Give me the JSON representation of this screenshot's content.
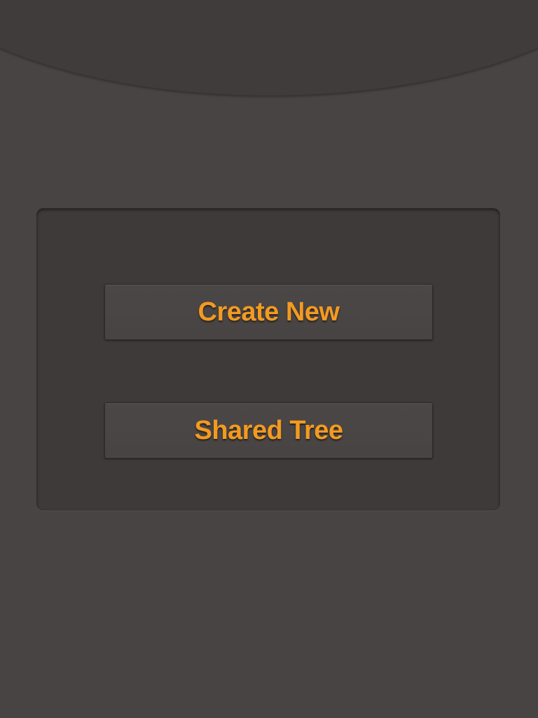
{
  "menu": {
    "create_new_label": "Create New",
    "shared_tree_label": "Shared Tree"
  },
  "colors": {
    "background": "#474443",
    "panel": "#3d3a39",
    "button": "#4a4645",
    "accent_text": "#f39a21"
  }
}
